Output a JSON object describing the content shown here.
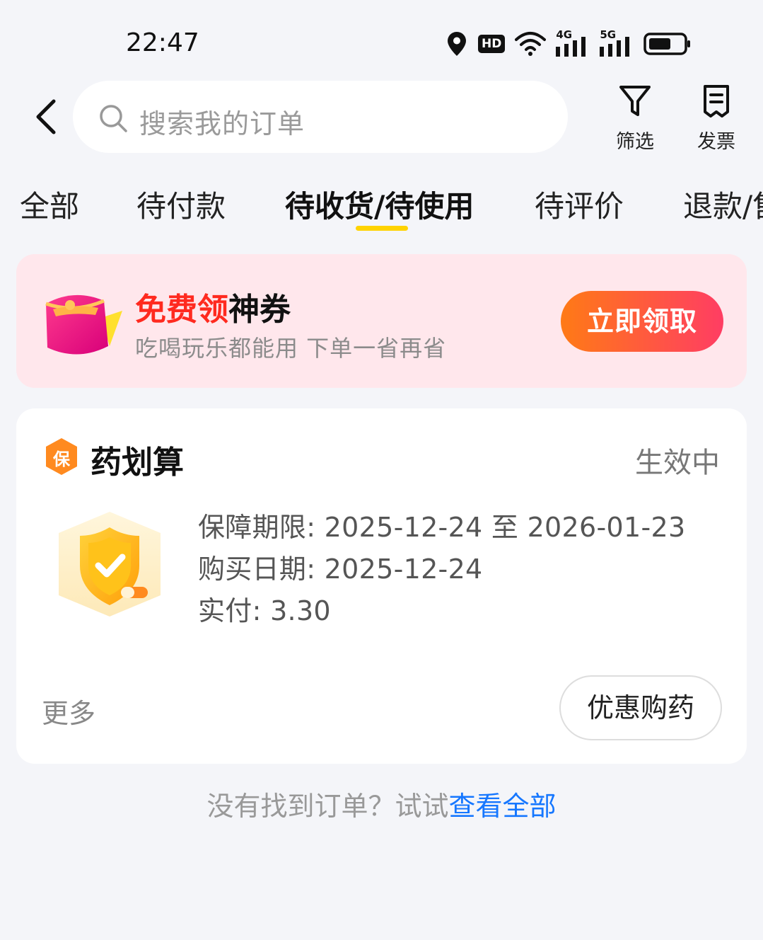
{
  "status_bar": {
    "time": "22:47",
    "hd_label": "HD",
    "net1": "4G",
    "net2": "5G"
  },
  "header": {
    "search_placeholder": "搜索我的订单",
    "filter_label": "筛选",
    "invoice_label": "发票"
  },
  "tabs": [
    {
      "label": "全部",
      "active": false
    },
    {
      "label": "待付款",
      "active": false
    },
    {
      "label": "待收货/待使用",
      "active": true
    },
    {
      "label": "待评价",
      "active": false
    },
    {
      "label": "退款/售后",
      "active": false
    }
  ],
  "coupon": {
    "title_red": "免费领",
    "title_black": "神券",
    "subtitle": "吃喝玩乐都能用 下单一省再省",
    "button": "立即领取"
  },
  "order": {
    "badge": "保",
    "shop_name": "药划算",
    "status": "生效中",
    "details": [
      "保障期限: 2025-12-24 至 2026-01-23",
      "购买日期: 2025-12-24",
      "实付: 3.30"
    ],
    "more": "更多",
    "action_button": "优惠购药"
  },
  "footer": {
    "hint": "没有找到订单？试试",
    "link": "查看全部"
  },
  "colors": {
    "accent_yellow": "#ffd300",
    "coupon_bg": "#ffe7ec",
    "coupon_red": "#ff2a1f",
    "button_gradient_start": "#ff7a16",
    "button_gradient_end": "#ff3d63",
    "link_blue": "#1677ff"
  }
}
